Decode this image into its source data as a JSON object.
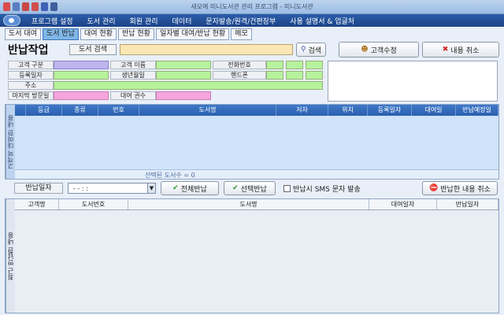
{
  "window": {
    "title": "새모에 미니도서관 관리 프로그램 - 미니도서관"
  },
  "menu": [
    "프로그램 설정",
    "도서 관리",
    "회원 관리",
    "데이터",
    "문자발송/원격/건편장부",
    "사용 설명서 & 업글처"
  ],
  "tabs": [
    "도서 대여",
    "도서 반납",
    "대여 현황",
    "반납 현황",
    "일자별 대여/반납 현황",
    "메모"
  ],
  "active_tab": "도서 반납",
  "toolbar": {
    "page_title": "반납작업",
    "search_label": "도서 검색",
    "search_button": "검색",
    "edit_customer_button": "고객수정",
    "cancel_button": "내용 취소"
  },
  "customer_info": {
    "customer_type": "고객 구분",
    "customer_name": "고객 이름",
    "phone": "전화번호",
    "register_date": "등록일자",
    "birth_month": "생년월일",
    "mobile": "핸드폰",
    "address": "주소",
    "last_visit": "마지막 방문일",
    "rental_count": "대여 권수"
  },
  "rental_grid": {
    "side_label": "고객의 대여한 내용",
    "columns": [
      "",
      "등급",
      "종류",
      "번호",
      "도서명",
      "저자",
      "위치",
      "등록일자",
      "대여일",
      "반납예정일"
    ],
    "rows": [],
    "footer": "선택된 도서수 = 0"
  },
  "return_bar": {
    "date_label": "반납일자",
    "date_value": "-   -      :   :",
    "all_return_button": "전체반납",
    "select_return_button": "선택반납",
    "sms_label": "반납시 SMS 문자 발송",
    "cancel_returned_button": "반납한 내용 취소"
  },
  "returned_grid": {
    "side_label": "최근 반납한 내용",
    "columns": [
      "고객명",
      "도서번호",
      "도서명",
      "대여일자",
      "반납일자"
    ],
    "rows": []
  },
  "colors": {
    "accent": "#2a5fae",
    "field_green": "#b7f29c",
    "field_purple": "#bfb5ef",
    "field_pink": "#f6a6df",
    "search_yellow": "#fbe7b5"
  }
}
